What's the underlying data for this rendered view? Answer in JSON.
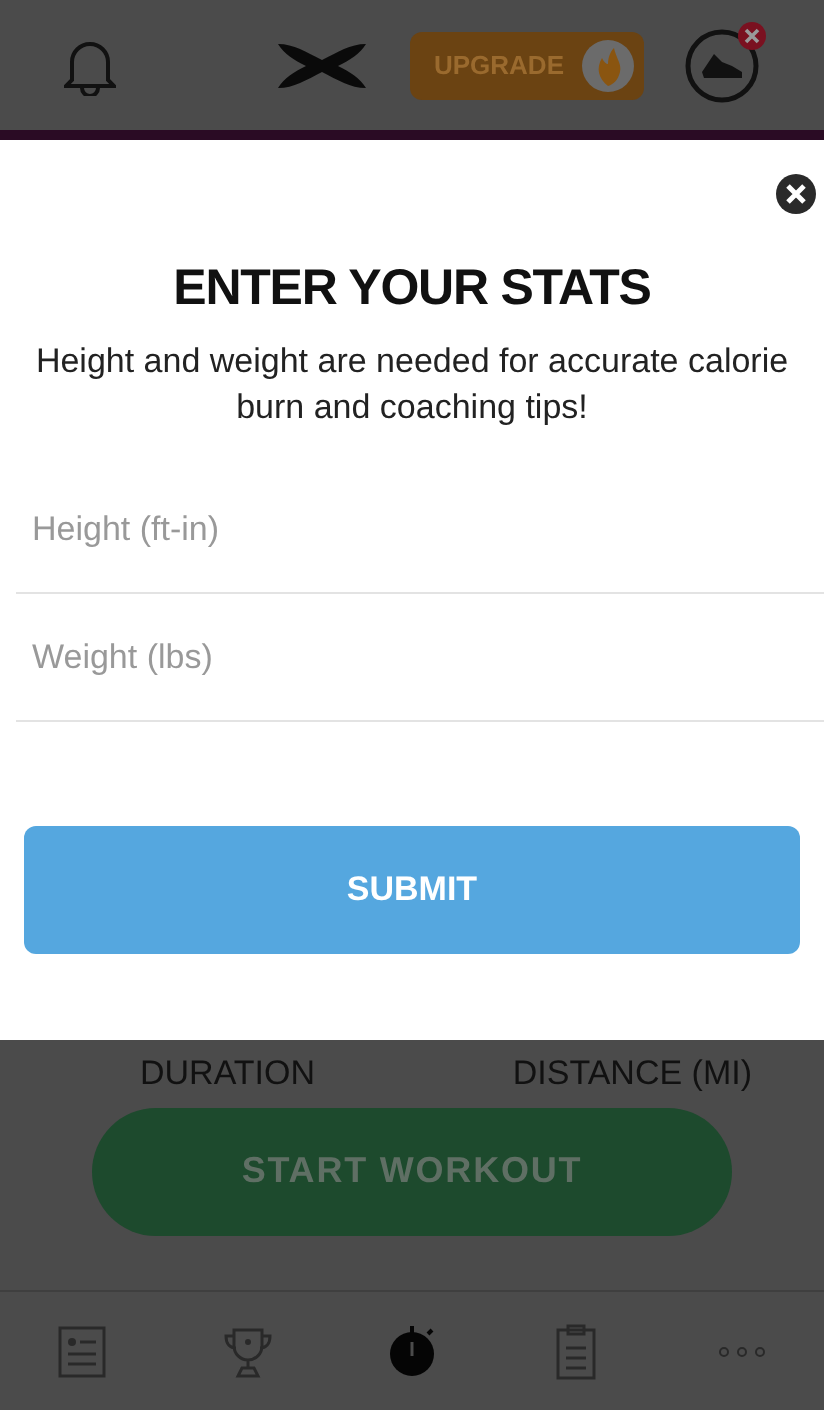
{
  "header": {
    "upgrade": "UPGRADE"
  },
  "modal": {
    "title": "ENTER YOUR STATS",
    "message": "Height and weight are needed for accurate calorie burn and coaching tips!",
    "fields": [
      {
        "placeholder": "Height (ft-in)"
      },
      {
        "placeholder": "Weight (lbs)"
      }
    ],
    "submit": "SUBMIT"
  },
  "background": {
    "labels": [
      "DURATION",
      "DISTANCE (MI)"
    ],
    "start": "START WORKOUT"
  },
  "nav": [
    {
      "kind": "feed",
      "selected": false
    },
    {
      "kind": "challenges",
      "selected": false
    },
    {
      "kind": "record",
      "selected": true
    },
    {
      "kind": "plans",
      "selected": false
    },
    {
      "kind": "more",
      "selected": false
    }
  ]
}
